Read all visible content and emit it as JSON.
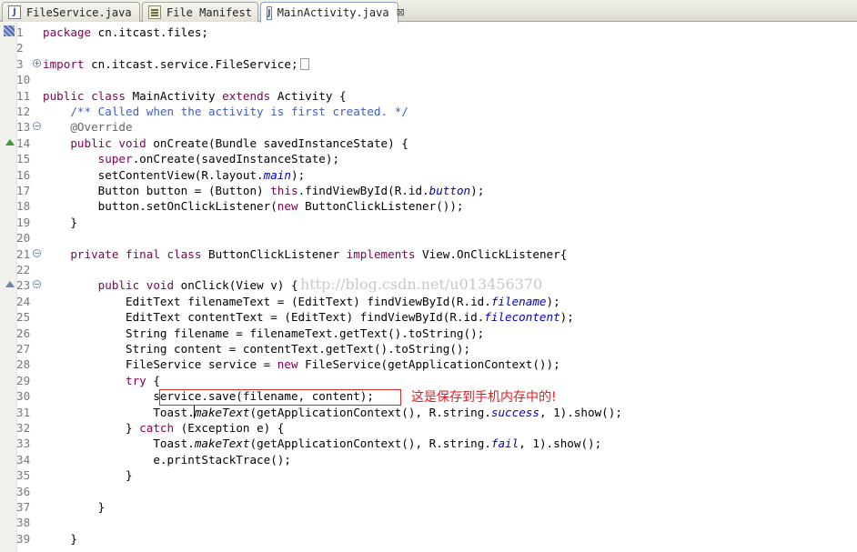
{
  "tabs": [
    {
      "label": "FileService.java",
      "icon": "java-file-icon",
      "active": false
    },
    {
      "label": "File Manifest",
      "icon": "manifest-file-icon",
      "active": false
    },
    {
      "label": "MainActivity.java",
      "icon": "java-file-icon",
      "active": true
    }
  ],
  "close_glyph": "⊠",
  "colors": {
    "keyword": "#7f0055",
    "comment": "#3f5fbf",
    "annotation": "#646464",
    "field": "#0000c0",
    "line_number": "#787878",
    "note_red": "#e4191d"
  },
  "watermark": "http://blog.csdn.net/u013456370",
  "annotation_note": "这是保存到手机内存中的!",
  "lines": [
    {
      "n": "1",
      "segs": [
        [
          "kw",
          "package"
        ],
        [
          "",
          "cn.itcast.files;"
        ]
      ]
    },
    {
      "n": "2",
      "segs": []
    },
    {
      "n": "3",
      "fold": "+",
      "segs": [
        [
          "kw",
          "import"
        ],
        [
          "",
          "cn.itcast.service.FileService;"
        ]
      ],
      "collapsed": true
    },
    {
      "n": "10",
      "segs": []
    },
    {
      "n": "11",
      "segs": [
        [
          "kw",
          "public class"
        ],
        [
          "",
          " MainActivity "
        ],
        [
          "kw",
          "extends"
        ],
        [
          "",
          " Activity {"
        ]
      ]
    },
    {
      "n": "12",
      "segs": [
        [
          "",
          "    "
        ],
        [
          "cm",
          "/** Called when the activity is first created. */"
        ]
      ]
    },
    {
      "n": "13",
      "fold": "-",
      "segs": [
        [
          "",
          "    "
        ],
        [
          "an",
          "@Override"
        ]
      ]
    },
    {
      "n": "14",
      "overview": "green",
      "segs": [
        [
          "",
          "    "
        ],
        [
          "kw",
          "public void"
        ],
        [
          "",
          " onCreate(Bundle savedInstanceState) {"
        ]
      ]
    },
    {
      "n": "15",
      "segs": [
        [
          "",
          "        "
        ],
        [
          "kw",
          "super"
        ],
        [
          "",
          ".onCreate(savedInstanceState);"
        ]
      ]
    },
    {
      "n": "16",
      "segs": [
        [
          "",
          "        setContentView(R.layout."
        ],
        [
          "st",
          "main"
        ],
        [
          "",
          ");"
        ]
      ]
    },
    {
      "n": "17",
      "segs": [
        [
          "",
          "        Button button = (Button) "
        ],
        [
          "kw",
          "this"
        ],
        [
          "",
          ".findViewById(R.id."
        ],
        [
          "st",
          "button"
        ],
        [
          "",
          ");"
        ]
      ]
    },
    {
      "n": "18",
      "segs": [
        [
          "",
          "        button.setOnClickListener("
        ],
        [
          "kw",
          "new"
        ],
        [
          "",
          " ButtonClickListener());"
        ]
      ]
    },
    {
      "n": "19",
      "segs": [
        [
          "",
          "    }"
        ]
      ]
    },
    {
      "n": "20",
      "segs": []
    },
    {
      "n": "21",
      "fold": "-",
      "segs": [
        [
          "",
          "    "
        ],
        [
          "kw",
          "private final class"
        ],
        [
          "",
          " ButtonClickListener "
        ],
        [
          "kw",
          "implements"
        ],
        [
          "",
          " View.OnClickListener{"
        ]
      ]
    },
    {
      "n": "22",
      "segs": []
    },
    {
      "n": "23",
      "fold": "-",
      "overview": "hollow",
      "segs": [
        [
          "",
          "        "
        ],
        [
          "kw",
          "public void"
        ],
        [
          "",
          " onClick(View v) {"
        ]
      ]
    },
    {
      "n": "24",
      "segs": [
        [
          "",
          "            EditText filenameText = (EditText) findViewById(R.id."
        ],
        [
          "st",
          "filename"
        ],
        [
          "",
          ");"
        ]
      ]
    },
    {
      "n": "25",
      "segs": [
        [
          "",
          "            EditText contentText = (EditText) findViewById(R.id."
        ],
        [
          "st",
          "filecontent"
        ],
        [
          "",
          ");"
        ]
      ]
    },
    {
      "n": "26",
      "segs": [
        [
          "",
          "            String filename = filenameText.getText().toString();"
        ]
      ]
    },
    {
      "n": "27",
      "segs": [
        [
          "",
          "            String content = contentText.getText().toString();"
        ]
      ]
    },
    {
      "n": "28",
      "segs": [
        [
          "",
          "            FileService service = "
        ],
        [
          "kw",
          "new"
        ],
        [
          "",
          " FileService(getApplicationContext());"
        ]
      ]
    },
    {
      "n": "29",
      "segs": [
        [
          "",
          "            "
        ],
        [
          "kw",
          "try"
        ],
        [
          "",
          " {"
        ]
      ]
    },
    {
      "n": "30",
      "segs": [
        [
          "",
          "                service.save(filename, content);"
        ]
      ]
    },
    {
      "n": "31",
      "segs": [
        [
          "",
          "                Toast."
        ],
        [
          "ital",
          "makeText"
        ],
        [
          "",
          "(getApplicationContext(), R.string."
        ],
        [
          "st",
          "success"
        ],
        [
          "",
          ", 1).show();"
        ]
      ]
    },
    {
      "n": "32",
      "segs": [
        [
          "",
          "            } "
        ],
        [
          "kw",
          "catch"
        ],
        [
          "",
          " (Exception e) {"
        ]
      ]
    },
    {
      "n": "33",
      "segs": [
        [
          "",
          "                Toast."
        ],
        [
          "ital",
          "makeText"
        ],
        [
          "",
          "(getApplicationContext(), R.string."
        ],
        [
          "st",
          "fail"
        ],
        [
          "",
          ", 1).show();"
        ]
      ]
    },
    {
      "n": "34",
      "segs": [
        [
          "",
          "                e.printStackTrace();"
        ]
      ]
    },
    {
      "n": "35",
      "segs": [
        [
          "",
          "            }"
        ]
      ]
    },
    {
      "n": "36",
      "segs": []
    },
    {
      "n": "37",
      "segs": [
        [
          "",
          "        }"
        ]
      ]
    },
    {
      "n": "38",
      "segs": []
    },
    {
      "n": "39",
      "segs": [
        [
          "",
          "    }"
        ]
      ]
    }
  ]
}
